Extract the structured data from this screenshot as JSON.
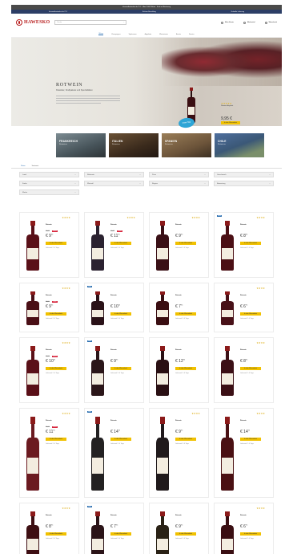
{
  "topbar": {
    "text": "Versandkostenfrei ab 75 € · Über 2.000 Weine · Kauf auf Rechnung"
  },
  "promobar": {
    "items": [
      "Versandkostenfrei ab 75 €",
      "Sichere Bezahlung",
      "Schnelle Lieferung"
    ]
  },
  "header": {
    "logo": "HAWESKO",
    "search_placeholder": "Suche",
    "actions": [
      "Mein Konto",
      "Merkzettel",
      "Warenkorb"
    ]
  },
  "nav": {
    "items": [
      "Weine",
      "Champagner",
      "Spirituosen",
      "Angebote",
      "Weinwissen",
      "Events",
      "Service"
    ],
    "active_index": 0
  },
  "hero": {
    "title": "ROTWEIN",
    "subtitle": "Klassiker, Kraftpakete und Spezialitäten",
    "badge": "Unser Tipp",
    "product_name": "Rotwein Angebot",
    "price": "9,95 €"
  },
  "regions": [
    {
      "title": "FRANKREICH",
      "sub": "Rotweine"
    },
    {
      "title": "ITALIEN",
      "sub": "Rotweine"
    },
    {
      "title": "SPANIEN",
      "sub": "Rotweine"
    },
    {
      "title": "CHILE",
      "sub": "Rotweine"
    }
  ],
  "tabs": {
    "items": [
      "Weine",
      "Sortiment"
    ],
    "active_index": 0
  },
  "filters": [
    "Land",
    "Rebsorte",
    "Preis",
    "Geschmack",
    "Farbe",
    "Weinstil",
    "Region",
    "Bewertung",
    "Marke"
  ],
  "products": [
    {
      "badge": "",
      "stars": "★★★★",
      "name": "Rotwein",
      "old": "12,90",
      "sale": "-20%",
      "price": "9",
      "cents": "95",
      "btn": "In den Warenkorb",
      "ship": "Lieferzeit 2–4 Tage",
      "color": "#5a1018"
    },
    {
      "badge": "",
      "stars": "★★★★",
      "name": "Rotwein",
      "old": "14,90",
      "sale": "-25%",
      "price": "11",
      "cents": "95",
      "btn": "In den Warenkorb",
      "ship": "Lieferzeit 2–4 Tage",
      "color": "#2b2230"
    },
    {
      "badge": "",
      "stars": "★★★★",
      "name": "Rotwein",
      "old": "",
      "sale": "",
      "price": "9",
      "cents": "95",
      "btn": "In den Warenkorb",
      "ship": "Lieferzeit 2–4 Tage",
      "color": "#3a1016"
    },
    {
      "badge": "NEU",
      "stars": "★★★★",
      "name": "Rotwein",
      "old": "",
      "sale": "",
      "price": "8",
      "cents": "95",
      "btn": "In den Warenkorb",
      "ship": "Lieferzeit 2–4 Tage",
      "color": "#4b0f14"
    },
    {
      "badge": "",
      "stars": "★★★★",
      "name": "Rotwein",
      "old": "11,90",
      "sale": "-15%",
      "price": "9",
      "cents": "95",
      "btn": "In den Warenkorb",
      "ship": "Lieferzeit 2–4 Tage",
      "color": "#4a0f16"
    },
    {
      "badge": "NEU",
      "stars": "",
      "name": "Rotwein",
      "old": "",
      "sale": "",
      "price": "10",
      "cents": "95",
      "btn": "In den Warenkorb",
      "ship": "Lieferzeit 2–4 Tage",
      "color": "#2a1218"
    },
    {
      "badge": "",
      "stars": "",
      "name": "Rotwein",
      "old": "",
      "sale": "",
      "price": "7",
      "cents": "95",
      "btn": "In den Warenkorb",
      "ship": "Lieferzeit 2–4 Tage",
      "color": "#3a0e12"
    },
    {
      "badge": "",
      "stars": "★★★★",
      "name": "Rotwein",
      "old": "",
      "sale": "",
      "price": "6",
      "cents": "95",
      "btn": "In den Warenkorb",
      "ship": "Lieferzeit 2–4 Tage",
      "color": "#481118"
    },
    {
      "badge": "",
      "stars": "★★★★",
      "name": "Rotwein",
      "old": "13,90",
      "sale": "-20%",
      "price": "10",
      "cents": "95",
      "btn": "In den Warenkorb",
      "ship": "Lieferzeit 2–4 Tage",
      "color": "#5a1018"
    },
    {
      "badge": "NEU",
      "stars": "",
      "name": "Rotwein",
      "old": "",
      "sale": "",
      "price": "9",
      "cents": "95",
      "btn": "In den Warenkorb",
      "ship": "Lieferzeit 2–4 Tage",
      "color": "#2b1619"
    },
    {
      "badge": "",
      "stars": "",
      "name": "Rotwein",
      "old": "",
      "sale": "",
      "price": "12",
      "cents": "95",
      "btn": "In den Warenkorb",
      "ship": "Lieferzeit 2–4 Tage",
      "color": "#2a1014"
    },
    {
      "badge": "",
      "stars": "★★★★",
      "name": "Rotwein",
      "old": "",
      "sale": "",
      "price": "8",
      "cents": "95",
      "btn": "In den Warenkorb",
      "ship": "Lieferzeit 2–4 Tage",
      "color": "#3b0f15"
    },
    {
      "badge": "",
      "stars": "★★★★",
      "name": "Rotwein",
      "old": "15,90",
      "sale": "-25%",
      "price": "11",
      "cents": "95",
      "btn": "In den Warenkorb",
      "ship": "Lieferzeit 2–4 Tage",
      "color": "#6b1a20"
    },
    {
      "badge": "NEU",
      "stars": "",
      "name": "Rotwein",
      "old": "",
      "sale": "",
      "price": "14",
      "cents": "95",
      "btn": "In den Warenkorb",
      "ship": "Lieferzeit 2–4 Tage",
      "color": "#232122"
    },
    {
      "badge": "",
      "stars": "★★★★",
      "name": "Rotwein",
      "old": "",
      "sale": "",
      "price": "9",
      "cents": "95",
      "btn": "In den Warenkorb",
      "ship": "Lieferzeit 2–4 Tage",
      "color": "#201a1c"
    },
    {
      "badge": "",
      "stars": "★★★★",
      "name": "Rotwein",
      "old": "",
      "sale": "",
      "price": "14",
      "cents": "95",
      "btn": "In den Warenkorb",
      "ship": "Lieferzeit 2–4 Tage",
      "color": "#4a1013"
    },
    {
      "badge": "",
      "stars": "★★★★",
      "name": "Rotwein",
      "old": "",
      "sale": "",
      "price": "8",
      "cents": "95",
      "btn": "In den Warenkorb",
      "ship": "Lieferzeit 2–4 Tage",
      "color": "#3e0f13"
    },
    {
      "badge": "NEU",
      "stars": "",
      "name": "Rotwein",
      "old": "",
      "sale": "",
      "price": "7",
      "cents": "95",
      "btn": "In den Warenkorb",
      "ship": "Lieferzeit 2–4 Tage",
      "color": "#2b1418"
    },
    {
      "badge": "",
      "stars": "",
      "name": "Rotwein",
      "old": "",
      "sale": "",
      "price": "9",
      "cents": "95",
      "btn": "In den Warenkorb",
      "ship": "Lieferzeit 2–4 Tage",
      "color": "#2a2216"
    },
    {
      "badge": "",
      "stars": "★★★★",
      "name": "Rotwein",
      "old": "",
      "sale": "",
      "price": "6",
      "cents": "95",
      "btn": "In den Warenkorb",
      "ship": "Lieferzeit 2–4 Tage",
      "color": "#3a0e12"
    }
  ]
}
